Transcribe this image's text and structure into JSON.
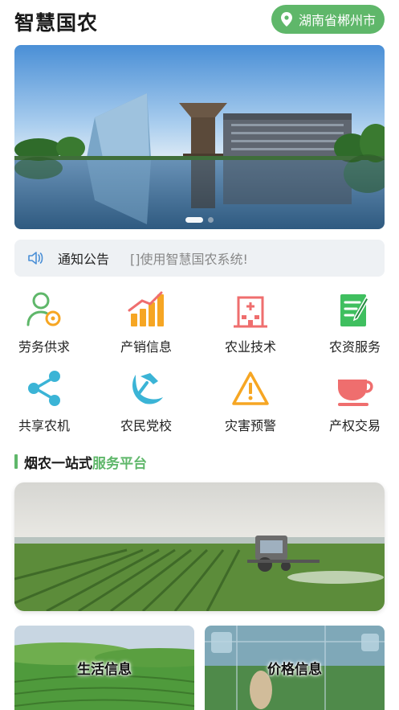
{
  "header": {
    "title": "智慧国农",
    "location": "湖南省郴州市",
    "location_icon": "location-pin-icon"
  },
  "banner": {
    "slide_count": 2,
    "active_slide": 1
  },
  "notice": {
    "label": "通知公告",
    "text": "[]使用智慧国农系统!",
    "icon": "speaker-icon"
  },
  "menu": [
    {
      "label": "劳务供求",
      "icon": "person-gear-icon",
      "color": "#5fb76a"
    },
    {
      "label": "产销信息",
      "icon": "bar-chart-icon",
      "color": "#f6a623"
    },
    {
      "label": "农业技术",
      "icon": "hospital-icon",
      "color": "#ef6e6e"
    },
    {
      "label": "农资服务",
      "icon": "document-edit-icon",
      "color": "#3fbf5f"
    },
    {
      "label": "共享农机",
      "icon": "share-icon",
      "color": "#3bb4d6"
    },
    {
      "label": "农民党校",
      "icon": "party-emblem-icon",
      "color": "#3bb4d6"
    },
    {
      "label": "灾害预警",
      "icon": "warning-icon",
      "color": "#f6a623"
    },
    {
      "label": "产权交易",
      "icon": "cup-icon",
      "color": "#ef6e6e"
    }
  ],
  "section": {
    "title_a": "烟农一站式",
    "title_b": "服务平台"
  },
  "cards": [
    {
      "label": "生活信息"
    },
    {
      "label": "价格信息"
    }
  ],
  "colors": {
    "accent": "#5fb76a",
    "notice_bg": "#eef1f4"
  }
}
